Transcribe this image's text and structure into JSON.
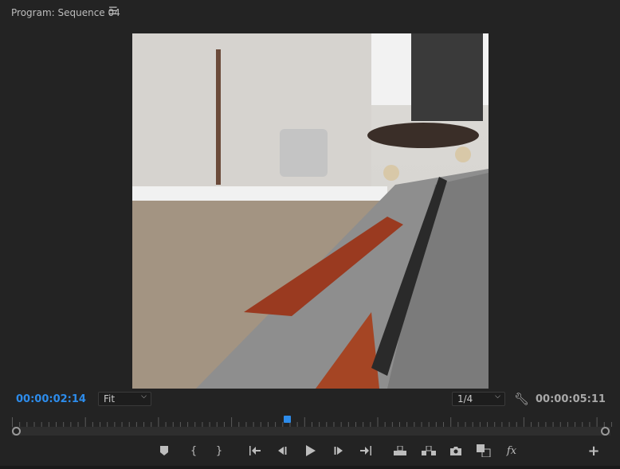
{
  "panel": {
    "title": "Program: Sequence 04",
    "menu_icon": "hamburger-menu-icon"
  },
  "monitor": {
    "current_timecode": "00:00:02:14",
    "duration_timecode": "00:00:05:11",
    "zoom_level": "Fit",
    "playback_resolution": "1/4",
    "playhead_fraction": 0.46,
    "accent_color": "#2d8ceb"
  },
  "transport": [
    {
      "name": "add-marker",
      "icon": "marker-icon"
    },
    {
      "name": "mark-in",
      "icon": "mark-in-icon"
    },
    {
      "name": "mark-out",
      "icon": "mark-out-icon"
    },
    {
      "name": "go-to-in",
      "icon": "go-to-in-icon"
    },
    {
      "name": "step-back",
      "icon": "step-back-icon"
    },
    {
      "name": "play",
      "icon": "play-icon"
    },
    {
      "name": "step-forward",
      "icon": "step-forward-icon"
    },
    {
      "name": "go-to-out",
      "icon": "go-to-out-icon"
    },
    {
      "name": "lift",
      "icon": "lift-icon"
    },
    {
      "name": "extract",
      "icon": "extract-icon"
    },
    {
      "name": "export-frame",
      "icon": "camera-icon"
    },
    {
      "name": "comparison-view",
      "icon": "compare-icon"
    },
    {
      "name": "global-fx-mute",
      "icon": "fx-icon",
      "label": "fx"
    },
    {
      "name": "button-editor",
      "icon": "plus-icon"
    }
  ]
}
